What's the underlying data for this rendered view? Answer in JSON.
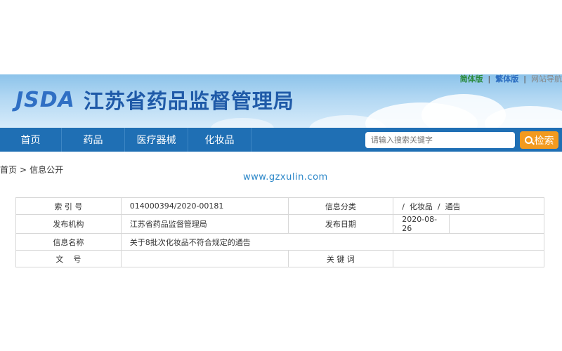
{
  "header": {
    "logo_en": "JSDA",
    "logo_cn": "江苏省药品监督管理局",
    "version_links": {
      "simplified": "简体版",
      "separator": "|",
      "traditional": "繁体版",
      "other": "网站导航"
    }
  },
  "nav": {
    "items": [
      {
        "label": "首页"
      },
      {
        "label": "药品"
      },
      {
        "label": "医疗器械"
      },
      {
        "label": "化妆品"
      }
    ],
    "search": {
      "placeholder": "请输入搜索关键字",
      "button_label": "检索"
    }
  },
  "breadcrumb": {
    "home": "首页",
    "separator": ">",
    "current": "信息公开"
  },
  "watermark": "www.gzxulin.com",
  "info": {
    "rows": [
      {
        "label1": "索 引 号",
        "value1": "014000394/2020-00181",
        "label2": "信息分类",
        "value2": "/  化妆品  /  通告"
      },
      {
        "label1": "发布机构",
        "value1": "江苏省药品监督管理局",
        "label2": "发布日期",
        "value2": "2020-08-26"
      },
      {
        "label1": "信息名称",
        "value1": "关于8批次化妆品不符合规定的通告"
      },
      {
        "label1": "文    号",
        "value1": "",
        "label2": "关 键 词",
        "value2": ""
      }
    ]
  },
  "colors": {
    "nav_bg": "#1f6fb4",
    "search_button": "#f29a1f",
    "logo": "#1f5aa8"
  }
}
